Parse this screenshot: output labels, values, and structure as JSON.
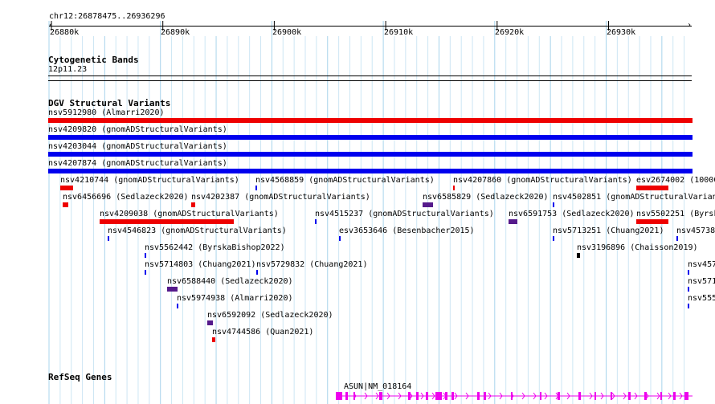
{
  "ruler": {
    "location": "chr12:26878475..26936296",
    "ticks": [
      "26880k",
      "26890k",
      "26900k",
      "26910k",
      "26920k",
      "26930k"
    ]
  },
  "tracks": {
    "cytoband": {
      "title": "Cytogenetic Bands",
      "band": "12p11.23"
    },
    "dgv": {
      "title": "DGV Structural Variants",
      "colors": {
        "loss": "#ee0000",
        "gain": "#0000ee",
        "complex": "#551a8b",
        "other": "#000000"
      },
      "features": [
        {
          "label": "nsv5912980 (Almarri2020)",
          "kind": "loss"
        },
        {
          "label": "nsv4209820 (gnomADStructuralVariants)",
          "kind": "gain"
        },
        {
          "label": "nsv4203044 (gnomADStructuralVariants)",
          "kind": "gain"
        },
        {
          "label": "nsv4207874 (gnomADStructuralVariants)",
          "kind": "gain"
        },
        {
          "label": "nsv4210744 (gnomADStructuralVariants)",
          "kind": "loss"
        },
        {
          "label": "nsv4568859 (gnomADStructuralVariants)",
          "kind": "gain"
        },
        {
          "label": "nsv4207860 (gnomADStructuralVariants)",
          "kind": "loss"
        },
        {
          "label": "esv2674002 (10000",
          "kind": "loss"
        },
        {
          "label": "nsv6456696 (Sedlazeck2020)",
          "kind": "loss"
        },
        {
          "label": "nsv4202387 (gnomADStructuralVariants)",
          "kind": "loss"
        },
        {
          "label": "nsv6585829 (Sedlazeck2020)",
          "kind": "complex"
        },
        {
          "label": "nsv4502851 (gnomADStructuralVariants",
          "kind": "gain"
        },
        {
          "label": "nsv4209038 (gnomADStructuralVariants)",
          "kind": "loss"
        },
        {
          "label": "nsv4515237 (gnomADStructuralVariants)",
          "kind": "gain"
        },
        {
          "label": "nsv6591753 (Sedlazeck2020)",
          "kind": "complex"
        },
        {
          "label": "nsv5502251 (Byrsk",
          "kind": "loss"
        },
        {
          "label": "nsv4546823 (gnomADStructuralVariants)",
          "kind": "gain"
        },
        {
          "label": "esv3653646 (Besenbacher2015)",
          "kind": "gain"
        },
        {
          "label": "nsv5713251 (Chuang2021)",
          "kind": "gain"
        },
        {
          "label": "nsv45738",
          "kind": "gain"
        },
        {
          "label": "nsv5562442 (ByrskaBishop2022)",
          "kind": "gain"
        },
        {
          "label": "nsv3196896 (Chaisson2019)",
          "kind": "other"
        },
        {
          "label": "nsv5714803 (Chuang2021)",
          "kind": "gain"
        },
        {
          "label": "nsv5729832 (Chuang2021)",
          "kind": "gain"
        },
        {
          "label": "nsv457",
          "kind": "gain"
        },
        {
          "label": "nsv6588440 (Sedlazeck2020)",
          "kind": "complex"
        },
        {
          "label": "nsv571",
          "kind": "gain"
        },
        {
          "label": "nsv5974938 (Almarri2020)",
          "kind": "gain"
        },
        {
          "label": "nsv555",
          "kind": "gain"
        },
        {
          "label": "nsv6592092 (Sedlazeck2020)",
          "kind": "complex"
        },
        {
          "label": "nsv4744586 (Quan2021)",
          "kind": "loss"
        }
      ]
    },
    "refseq": {
      "title": "RefSeq Genes",
      "gene": "ASUN|NM_018164",
      "gene_color": "#ee00ee"
    }
  }
}
